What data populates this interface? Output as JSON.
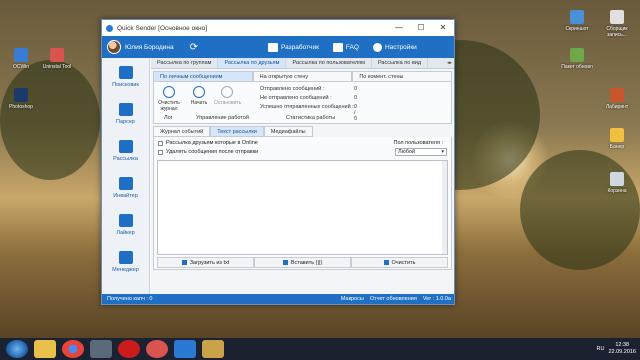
{
  "window": {
    "title": "Quick Sender [Основное окно]",
    "minimize": "—",
    "maximize": "☐",
    "close": "✕"
  },
  "header": {
    "user_name": "Юлия Бородина",
    "refresh": "⟳",
    "developer": "Разработчик",
    "faq": "FAQ",
    "settings": "Настройки"
  },
  "sidebar": {
    "items": [
      {
        "label": "Поиск­овик",
        "icon": "search-icon"
      },
      {
        "label": "Парсер",
        "icon": "megaphone-icon"
      },
      {
        "label": "Рассылка",
        "icon": "mail-icon"
      },
      {
        "label": "Инвайтер",
        "icon": "thumb-up-icon"
      },
      {
        "label": "Лайкер",
        "icon": "heart-icon"
      },
      {
        "label": "Менеджер",
        "icon": "person-icon"
      }
    ]
  },
  "tabs_main": [
    "Рассылка по группам",
    "Рассылка по друзьям",
    "Рассылка по пользователям",
    "Рассылка по вид"
  ],
  "tabs_main_active": 1,
  "tabs_sub": [
    "По личным сообщениям",
    "На открытую стену",
    "По комент. стены"
  ],
  "controls": {
    "clear_log": "Очистить журнал",
    "start": "Начать",
    "stop": "Остановить",
    "log_group": "Лог",
    "manage_group": "Управление работой",
    "stats_group": "Статистика работы"
  },
  "stats": {
    "sent_label": "Отправлено сообщений :",
    "sent_value": "0",
    "not_sent_label": "Не отправлено сообщений :",
    "not_sent_value": "0",
    "success_label": "Успешно отправленных сообщений :",
    "success_value": "0 / 0"
  },
  "tabs_panel": [
    "Журнал событий",
    "Текст рассылки",
    "Медиафайлы"
  ],
  "tabs_panel_active": 1,
  "panel": {
    "chk_online": "Рассылка друзьям которые в Online",
    "chk_delete": "Удалять сообщения после отправки",
    "select_title": "Пол пользователя :",
    "select_value": "Любой",
    "load_txt": "Загрузить из txt",
    "insert": "Вставить {||}",
    "clear": "Очистить"
  },
  "statusbar": {
    "captcha": "Получено капч : 0",
    "macros": "Макросы",
    "report": "Отчет обновления",
    "version": "Ver : 1.0.0a"
  },
  "desktop_icons": [
    "OCWin",
    "Uninstal Tool",
    "Photoshop",
    "Скриншот",
    "Сборщик запись...",
    "Пакет обновл",
    "Лабиринт",
    "Банер",
    "Корзина"
  ],
  "taskbar": {
    "lang": "RU",
    "time": "12:38",
    "date": "22.09.2016"
  }
}
